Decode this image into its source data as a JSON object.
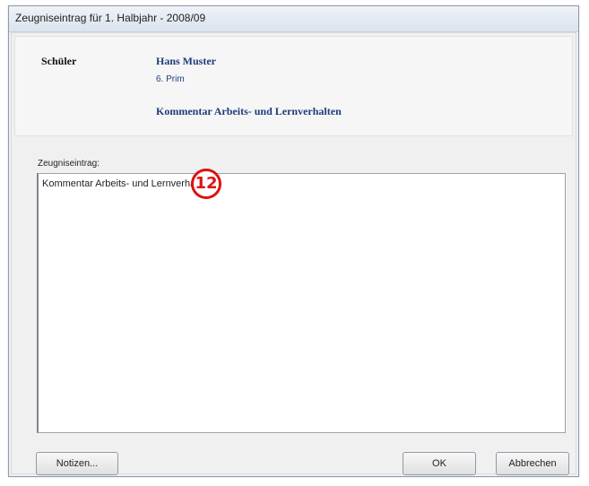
{
  "window": {
    "title": "Zeugniseintrag für 1. Halbjahr - 2008/09"
  },
  "header": {
    "student_label": "Schüler",
    "student_name": "Hans Muster",
    "student_class": "6. Prim",
    "entry_type": "Kommentar Arbeits- und Lernverhalten"
  },
  "entry": {
    "label": "Zeugniseintrag:",
    "value": "Kommentar Arbeits- und Lernverhalten"
  },
  "annotation": {
    "marker_number": "12",
    "color": "#e01010"
  },
  "buttons": {
    "notes_label": "Notizen...",
    "ok_label": "OK",
    "cancel_label": "Abbrechen"
  }
}
